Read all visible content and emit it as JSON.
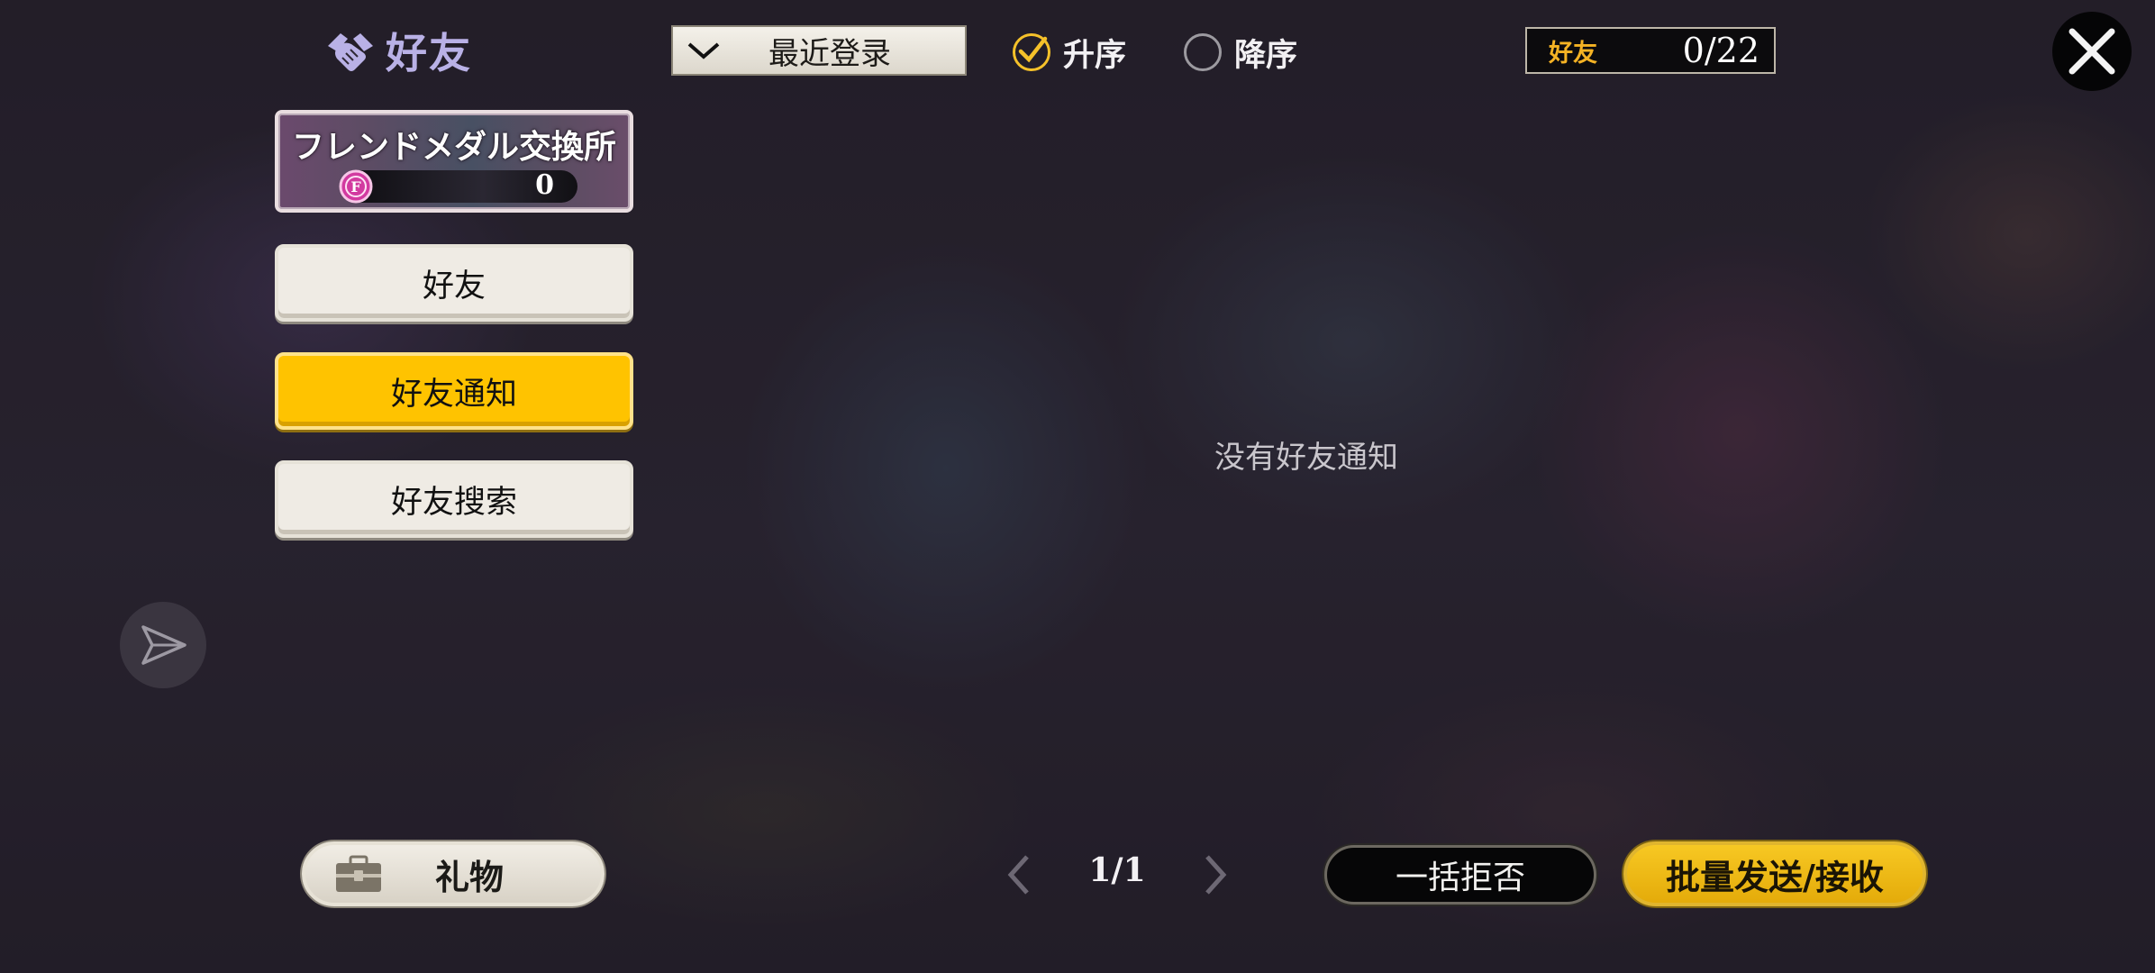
{
  "header": {
    "title": "好友",
    "title_icon": "handshake-icon",
    "sort": {
      "selected": "最近登录"
    },
    "order": {
      "asc_label": "升序",
      "desc_label": "降序",
      "selected": "asc"
    },
    "friend_count": {
      "label": "好友",
      "value": "0/22"
    }
  },
  "sidebar": {
    "medal_exchange": {
      "title": "フレンドメダル交換所",
      "coin_icon": "friend-medal-icon",
      "amount": "0"
    },
    "items": [
      {
        "label": "好友",
        "active": false
      },
      {
        "label": "好友通知",
        "active": true
      },
      {
        "label": "好友搜索",
        "active": false
      }
    ]
  },
  "main": {
    "empty_message": "没有好友通知"
  },
  "footer": {
    "gift_label": "礼物",
    "page": "1/1",
    "reject_all_label": "一括拒否",
    "batch_label": "批量发送/接收"
  },
  "colors": {
    "accent": "#ffc300",
    "title": "#b9b1e6",
    "count_label": "#f5b324"
  }
}
